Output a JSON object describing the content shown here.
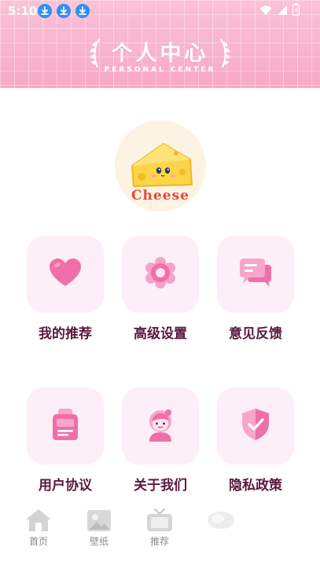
{
  "status_bar": {
    "time": "5:10"
  },
  "header": {
    "title": "个人中心",
    "subtitle": "PERSONAL CENTER"
  },
  "avatar": {
    "label": "Cheese"
  },
  "menu": [
    {
      "label": "我的推荐",
      "icon": "heart-icon"
    },
    {
      "label": "高级设置",
      "icon": "flower-settings-icon"
    },
    {
      "label": "意见反馈",
      "icon": "chat-bubbles-icon"
    },
    {
      "label": "用户协议",
      "icon": "clipboard-icon"
    },
    {
      "label": "关于我们",
      "icon": "girl-avatar-icon"
    },
    {
      "label": "隐私政策",
      "icon": "shield-check-icon"
    }
  ],
  "bottom_nav": [
    {
      "label": "首页",
      "icon": "home-icon"
    },
    {
      "label": "壁纸",
      "icon": "wallpaper-icon"
    },
    {
      "label": "推荐",
      "icon": "tv-icon"
    },
    {
      "label": "",
      "icon": "profile-icon"
    }
  ],
  "colors": {
    "header_pink": "#f9b6cf",
    "tile_bg": "#fdeff8",
    "icon_pink": "#f06fa8",
    "label_text": "#5a1a3c"
  }
}
